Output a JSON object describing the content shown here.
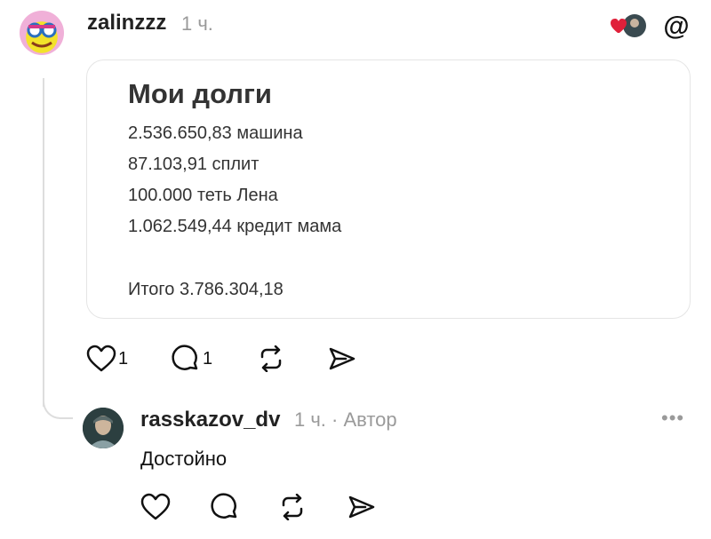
{
  "post": {
    "username": "zalinzzz",
    "time": "1 ч.",
    "card": {
      "title": "Мои долги",
      "items": [
        "2.536.650,83 машина",
        "87.103,91 сплит",
        "100.000 теть Лена",
        "1.062.549,44 кредит мама"
      ],
      "total": "Итого 3.786.304,18"
    },
    "actions": {
      "like_count": "1",
      "comment_count": "1"
    }
  },
  "reply": {
    "username": "rasskazov_dv",
    "time": "1 ч. · Автор",
    "text": "Достойно",
    "more": "•••"
  },
  "colors": {
    "accent_heart": "#e0203a",
    "text_muted": "#9a9a9a",
    "border": "#e5e5e5"
  }
}
